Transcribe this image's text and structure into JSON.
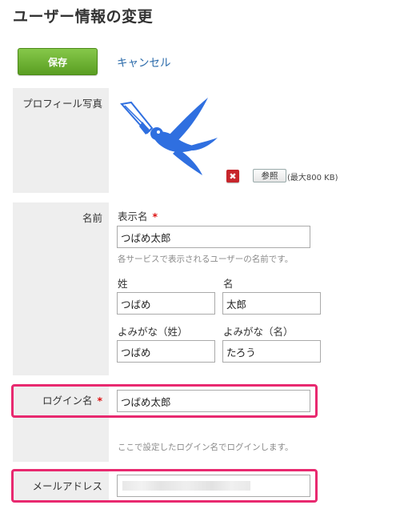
{
  "page": {
    "title": "ユーザー情報の変更"
  },
  "actions": {
    "save_label": "保存",
    "cancel_label": "キャンセル"
  },
  "photo": {
    "label": "プロフィール写真",
    "delete_glyph": "✖",
    "browse_label": "参照",
    "max_size_text": "(最大800 KB)"
  },
  "name": {
    "label": "名前",
    "display_name_label": "表示名",
    "required_mark": "*",
    "display_name_value": "つばめ太郎",
    "display_name_help": "各サービスで表示されるユーザーの名前です。",
    "last_name_label": "姓",
    "last_name_value": "つばめ",
    "first_name_label": "名",
    "first_name_value": "太郎",
    "last_kana_label": "よみがな（姓）",
    "last_kana_value": "つばめ",
    "first_kana_label": "よみがな（名）",
    "first_kana_value": "たろう"
  },
  "login": {
    "label": "ログイン名",
    "required_mark": "*",
    "value": "つばめ太郎",
    "help": "ここで設定したログイン名でログインします。"
  },
  "email": {
    "label": "メールアドレス",
    "value": ""
  },
  "colors": {
    "save_button": "#6aae2e",
    "link": "#2a6aaa",
    "highlight": "#e8296f",
    "bird": "#2f6fe0",
    "required": "#dd1111"
  },
  "icons": {
    "logo": "swallow-pen-icon",
    "delete": "close-icon"
  }
}
